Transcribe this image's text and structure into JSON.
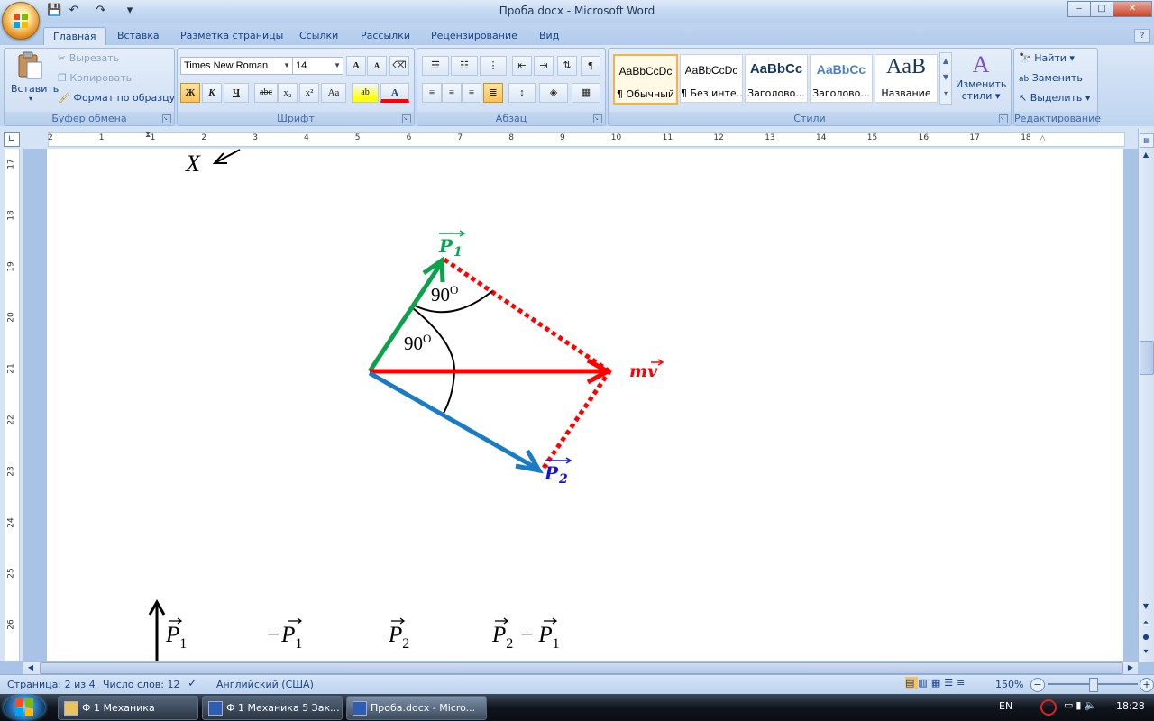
{
  "window": {
    "title": "Проба.docx - Microsoft Word",
    "controls": {
      "minimize": "‒",
      "maximize": "□",
      "close": "✕"
    },
    "doc_controls": {
      "minimize": "‒",
      "restore": "❐",
      "close": "✕"
    }
  },
  "quick_access": {
    "save_icon": "💾",
    "undo_icon": "↶",
    "redo_icon": "↷",
    "customize_icon": "▾"
  },
  "tabs": [
    {
      "label": "Главная",
      "active": true
    },
    {
      "label": "Вставка"
    },
    {
      "label": "Разметка страницы"
    },
    {
      "label": "Ссылки"
    },
    {
      "label": "Рассылки"
    },
    {
      "label": "Рецензирование"
    },
    {
      "label": "Вид"
    }
  ],
  "ribbon": {
    "clipboard": {
      "label": "Буфер обмена",
      "paste": "Вставить",
      "cut": "Вырезать",
      "copy": "Копировать",
      "format_painter": "Формат по образцу"
    },
    "font": {
      "label": "Шрифт",
      "font_name": "Times New Roman",
      "font_size": "14",
      "grow": "A",
      "shrink": "A",
      "bold": "Ж",
      "italic": "К",
      "underline": "Ч",
      "strike": "abc",
      "subscript": "x₂",
      "superscript": "x²",
      "case": "Aa",
      "highlight": "ab",
      "font_color": "A"
    },
    "paragraph": {
      "label": "Абзац"
    },
    "styles": {
      "label": "Стили",
      "items": [
        {
          "sample": "AaBbCcDc",
          "name": "¶ Обычный",
          "selected": true
        },
        {
          "sample": "AaBbCcDc",
          "name": "¶ Без инте..."
        },
        {
          "sample": "AaBbCc",
          "name": "Заголово..."
        },
        {
          "sample": "AaBbCc",
          "name": "Заголово..."
        },
        {
          "sample": "AaB",
          "name": "Название"
        }
      ],
      "change_styles_line1": "Изменить",
      "change_styles_line2": "стили"
    },
    "editing": {
      "label": "Редактирование",
      "find": "Найти",
      "replace": "Заменить",
      "select": "Выделить"
    }
  },
  "ruler": {
    "h_numbers": [
      "2",
      "1",
      "1",
      "2",
      "3",
      "4",
      "5",
      "6",
      "7",
      "8",
      "9",
      "10",
      "11",
      "12",
      "13",
      "14",
      "15",
      "16",
      "17",
      "18"
    ],
    "v_numbers": [
      "17",
      "18",
      "19",
      "20",
      "21",
      "22",
      "23",
      "24",
      "25",
      "26"
    ]
  },
  "document": {
    "top_label": "X",
    "p1_label": "P",
    "p1_sub": "1",
    "p2_label": "P",
    "p2_sub": "2",
    "mv_label": "mv",
    "angle_top": "90",
    "angle_top_sup": "O",
    "angle_mid": "90",
    "angle_mid_sup": "O",
    "bottom_row": [
      {
        "sign": "",
        "letter": "P",
        "sub": "1"
      },
      {
        "sign": "−",
        "letter": "P",
        "sub": "1"
      },
      {
        "sign": "",
        "letter": "P",
        "sub": "2"
      },
      {
        "sign": "",
        "letter": "P",
        "sub": "2",
        "minus": "−",
        "letter2": "P",
        "sub2": "1"
      }
    ],
    "colors": {
      "green": "#0aa24a",
      "red": "#ff0000",
      "blue": "#1a7cc4",
      "label_green": "#00a84f",
      "label_blue": "#1414d6"
    }
  },
  "status": {
    "page": "Страница: 2 из 4",
    "words": "Число слов: 12",
    "language": "Английский (США)",
    "zoom": "150%"
  },
  "taskbar": {
    "items": [
      "Ф 1 Механика",
      "Ф 1 Механика 5 Зак...",
      "Проба.docx - Micro..."
    ],
    "lang": "EN",
    "time": "18:28"
  }
}
